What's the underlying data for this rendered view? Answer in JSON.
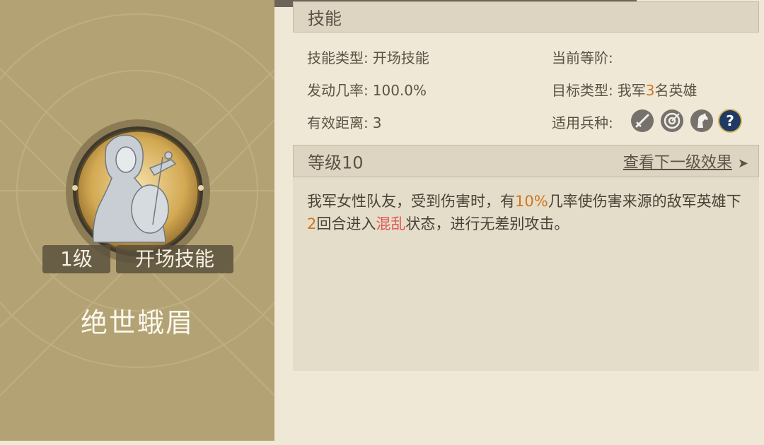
{
  "skill": {
    "name": "绝世蛾眉",
    "level_badge": "1级",
    "type_badge": "开场技能"
  },
  "skills_section": {
    "header": "技能",
    "type_label": "技能类型:",
    "type_value": "开场技能",
    "rank_label": "当前等阶:",
    "rank_value": "",
    "trigger_label": "发动几率:",
    "trigger_value": "100.0%",
    "target_label": "目标类型:",
    "target_prefix": "我军",
    "target_count": "3",
    "target_suffix": "名英雄",
    "range_label": "有效距离:",
    "range_value": "3",
    "troops_label": "适用兵种:",
    "troop_icons": [
      "sword-icon",
      "target-icon",
      "horse-icon",
      "question-icon"
    ]
  },
  "level_section": {
    "header": "等级10",
    "next_link": "查看下一级效果",
    "desc_part1": "我军女性队友，受到伤害时，有",
    "desc_chance": "10%",
    "desc_part2": "几率使伤害来源的敌军英雄下",
    "desc_rounds": "2",
    "desc_part3": "回合进入",
    "desc_status": "混乱",
    "desc_part4": "状态，进行无差别攻击。"
  },
  "colors": {
    "highlight": "#d0761d",
    "status": "#e0554f",
    "panel": "#b3a374"
  }
}
